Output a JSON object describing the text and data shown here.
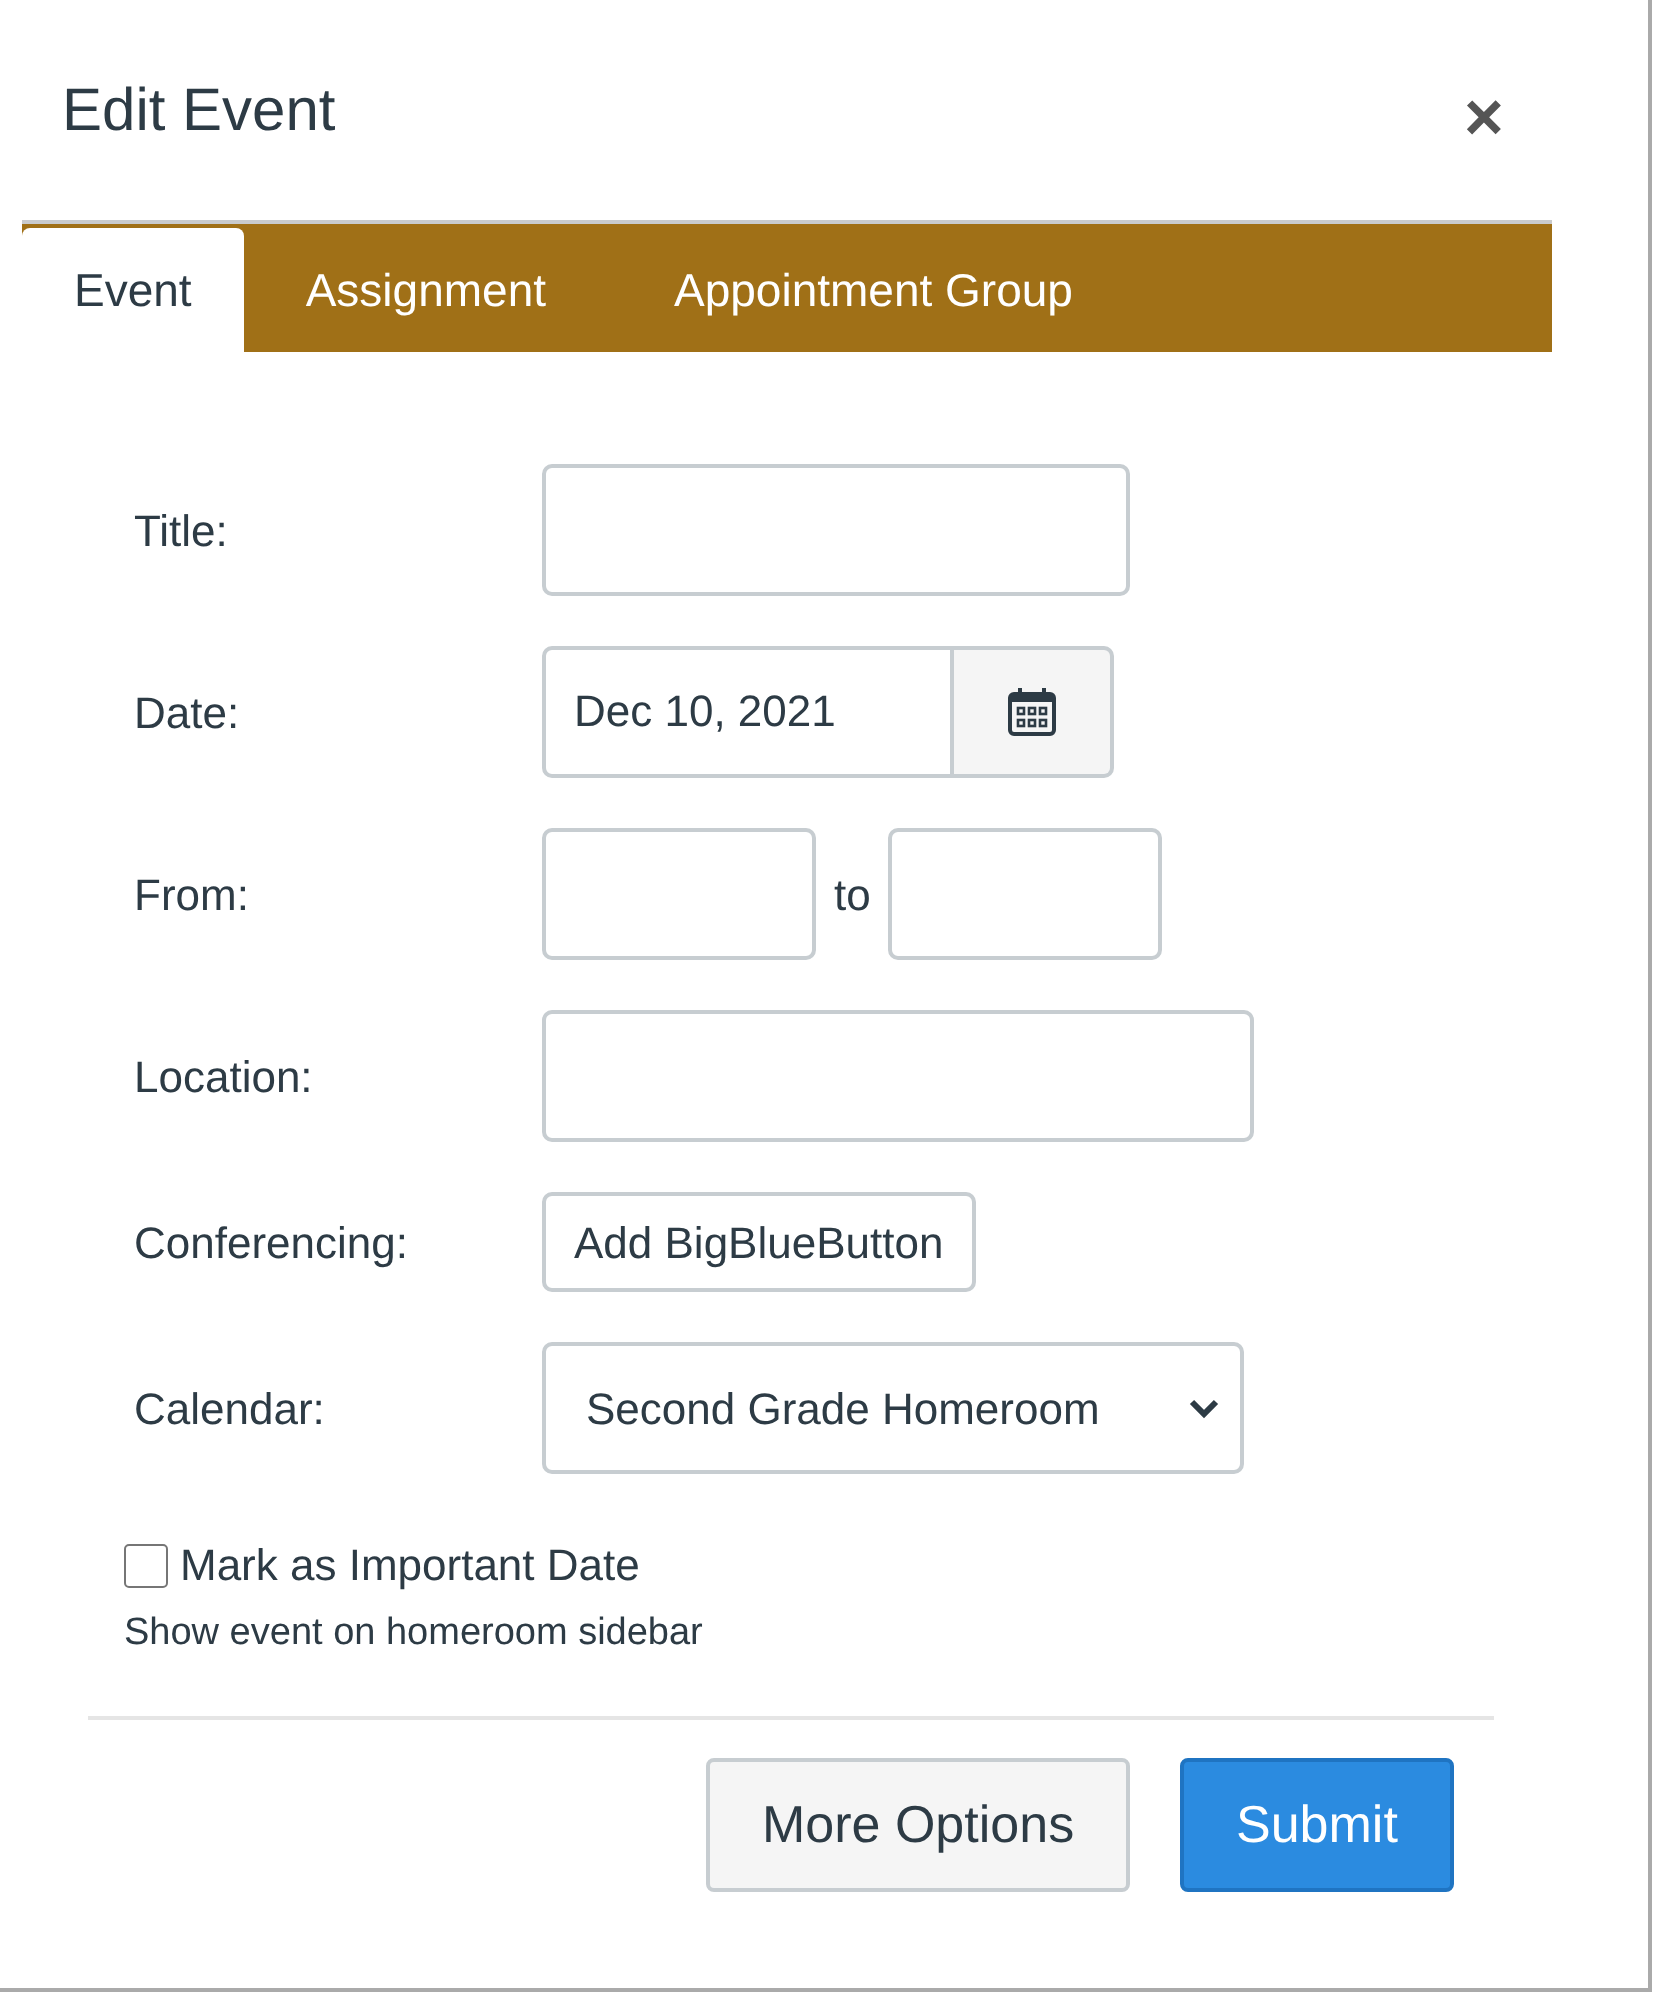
{
  "dialog": {
    "title": "Edit Event",
    "close": "×"
  },
  "tabs": [
    {
      "label": "Event",
      "selected": true
    },
    {
      "label": "Assignment",
      "selected": false
    },
    {
      "label": "Appointment Group",
      "selected": false
    }
  ],
  "fields": [
    {
      "label": "Title:",
      "kind": "text"
    },
    {
      "label": "Date:",
      "kind": "date",
      "value": "Dec 10, 2021"
    },
    {
      "label": "From:",
      "kind": "range",
      "joiner": "to"
    },
    {
      "label": "Location:",
      "kind": "text"
    },
    {
      "label": "Conferencing:",
      "kind": "button",
      "button": "Add BigBlueButton"
    },
    {
      "label": "Calendar:",
      "kind": "select",
      "value": "Second Grade Homeroom"
    }
  ],
  "important": {
    "label": "Mark as Important Date",
    "checked": false,
    "help": "Show event on homeroom sidebar"
  },
  "buttons": [
    {
      "label": "More Options",
      "kind": "secondary"
    },
    {
      "label": "Submit",
      "kind": "primary"
    }
  ]
}
